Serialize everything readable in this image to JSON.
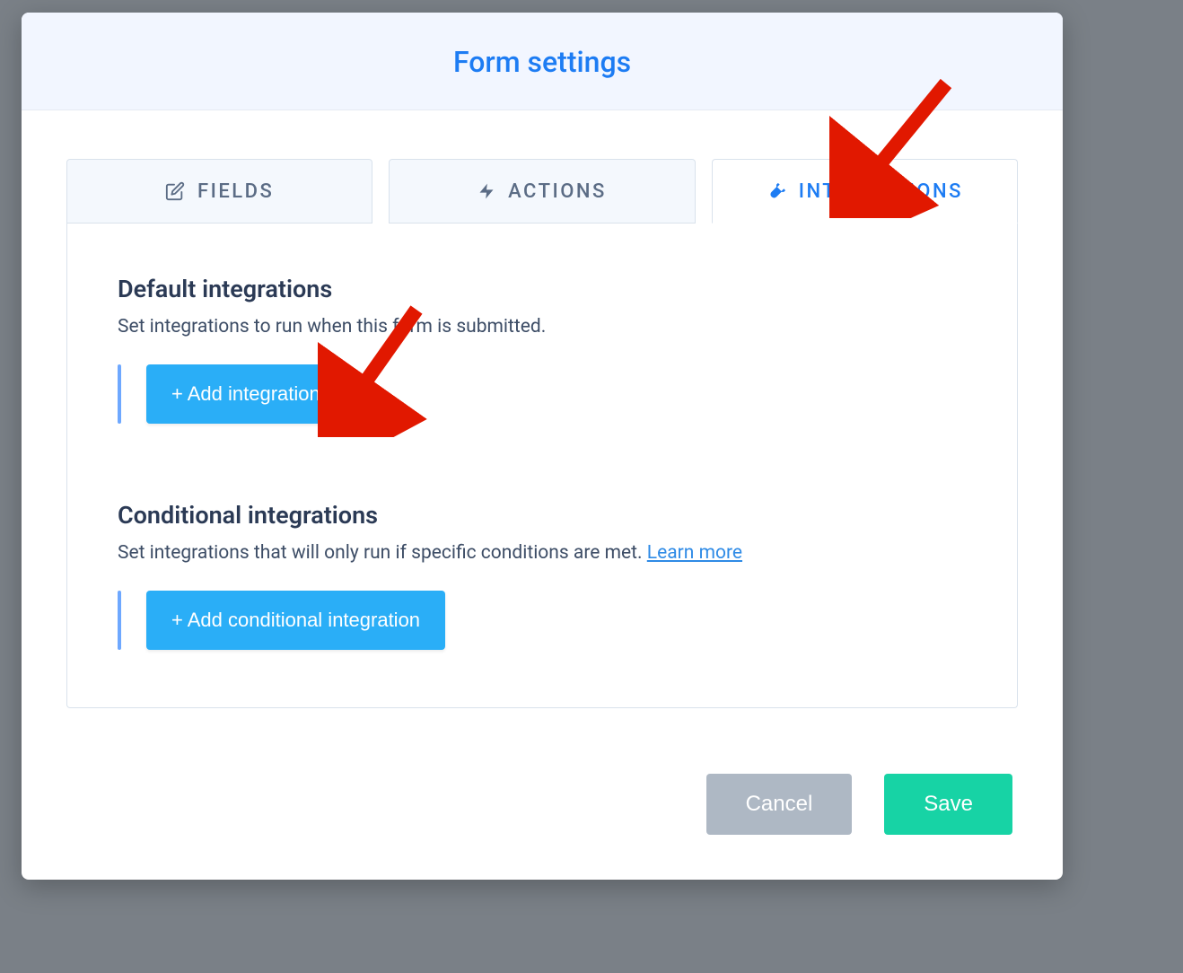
{
  "modal": {
    "title": "Form settings"
  },
  "tabs": {
    "fields": "FIELDS",
    "actions": "ACTIONS",
    "integrations": "INTEGRATIONS"
  },
  "sections": {
    "default": {
      "title": "Default integrations",
      "desc": "Set integrations to run when this form is submitted.",
      "button": "+ Add integration"
    },
    "conditional": {
      "title": "Conditional integrations",
      "desc_text": "Set integrations that will only run if specific conditions are met. ",
      "learn_more": "Learn more",
      "button": "+ Add conditional integration"
    }
  },
  "footer": {
    "cancel": "Cancel",
    "save": "Save"
  },
  "colors": {
    "accent": "#1d7cf3",
    "button_primary": "#2aaef7",
    "save": "#17d3a5",
    "cancel": "#aeb8c4",
    "annotation": "#e11800"
  }
}
